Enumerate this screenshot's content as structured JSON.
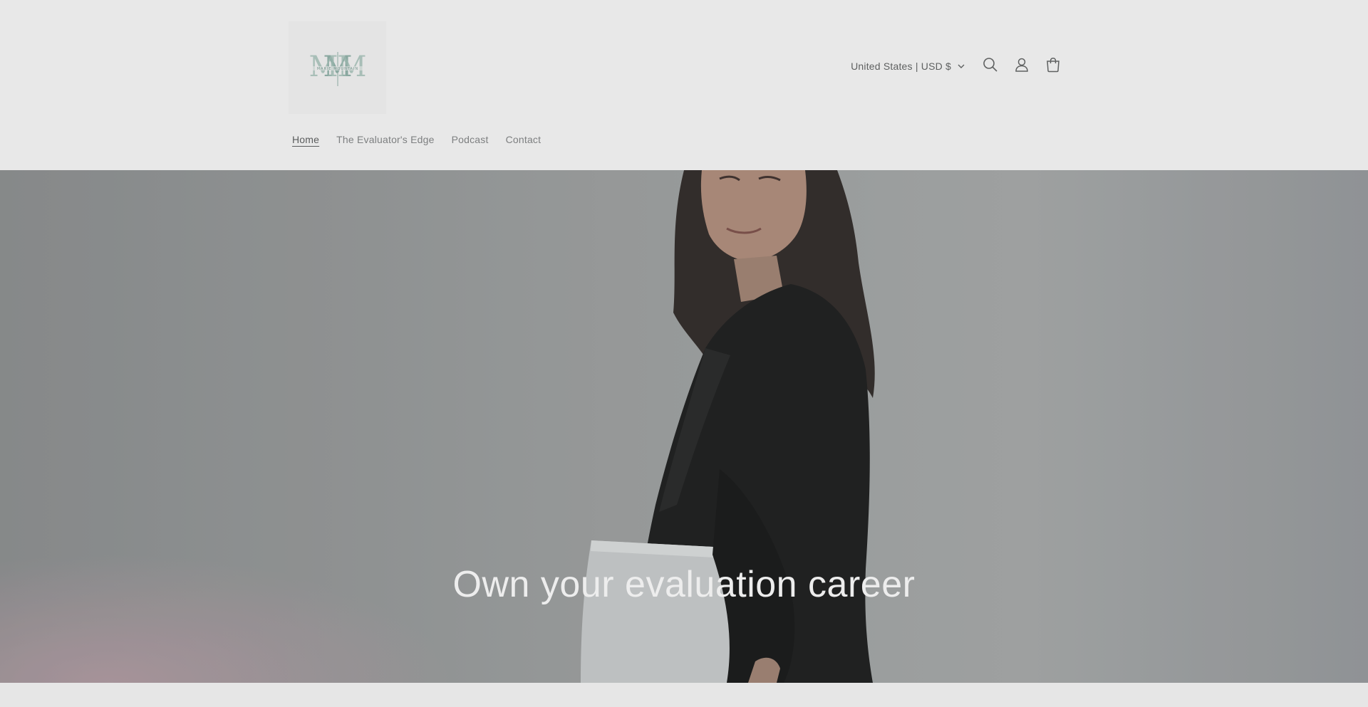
{
  "header": {
    "logo_text": "M M",
    "logo_subtext": "MARIE MOUNTAIN",
    "country_selector": "United States | USD $",
    "icons": {
      "search": "search-icon",
      "account": "account-icon",
      "cart": "cart-icon",
      "dropdown": "chevron-down-icon"
    }
  },
  "nav": {
    "items": [
      {
        "label": "Home",
        "active": true
      },
      {
        "label": "The Evaluator's Edge",
        "active": false
      },
      {
        "label": "Podcast",
        "active": false
      },
      {
        "label": "Contact",
        "active": false
      }
    ]
  },
  "hero": {
    "heading": "Own your evaluation career"
  },
  "colors": {
    "header_bg": "#e8e8e8",
    "logo_accent": "#8aa8a0",
    "nav_text": "#7d7f80",
    "hero_text": "#ededed"
  }
}
